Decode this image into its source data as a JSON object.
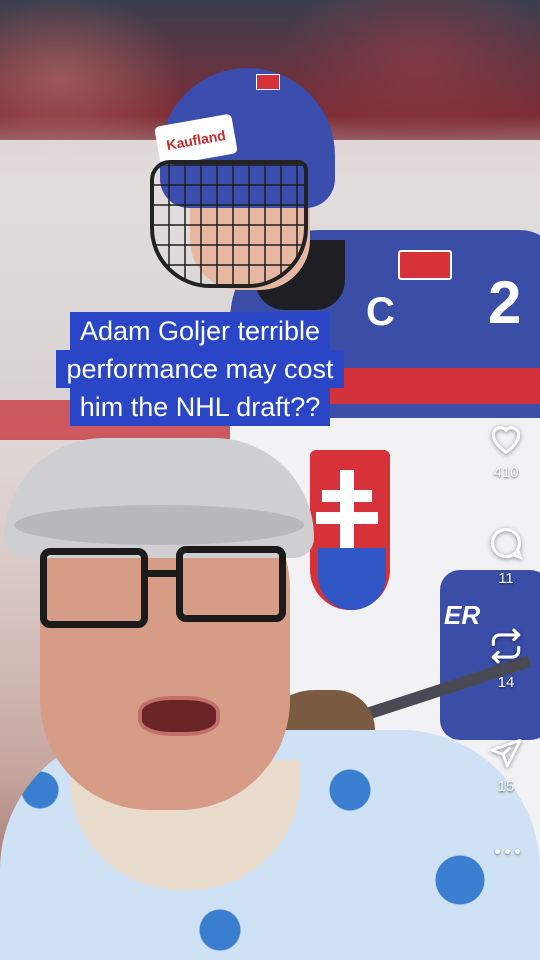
{
  "video": {
    "caption_lines": [
      "Adam Goljer terrible",
      "performance may cost",
      "him the NHL draft??"
    ],
    "background_marks": {
      "helmet_sponsor": "Kaufland",
      "jersey_letter": "C",
      "jersey_number": "2"
    }
  },
  "actions": {
    "like": {
      "icon": "heart-icon",
      "count": "410"
    },
    "comment": {
      "icon": "comment-icon",
      "count": "11"
    },
    "repost": {
      "icon": "repost-icon",
      "count": "14"
    },
    "share": {
      "icon": "send-icon",
      "count": "15"
    },
    "more": {
      "icon": "more-icon"
    }
  },
  "colors": {
    "caption_bg": "#2a46c6",
    "caption_text": "#ffffff",
    "icon": "#ffffff"
  }
}
